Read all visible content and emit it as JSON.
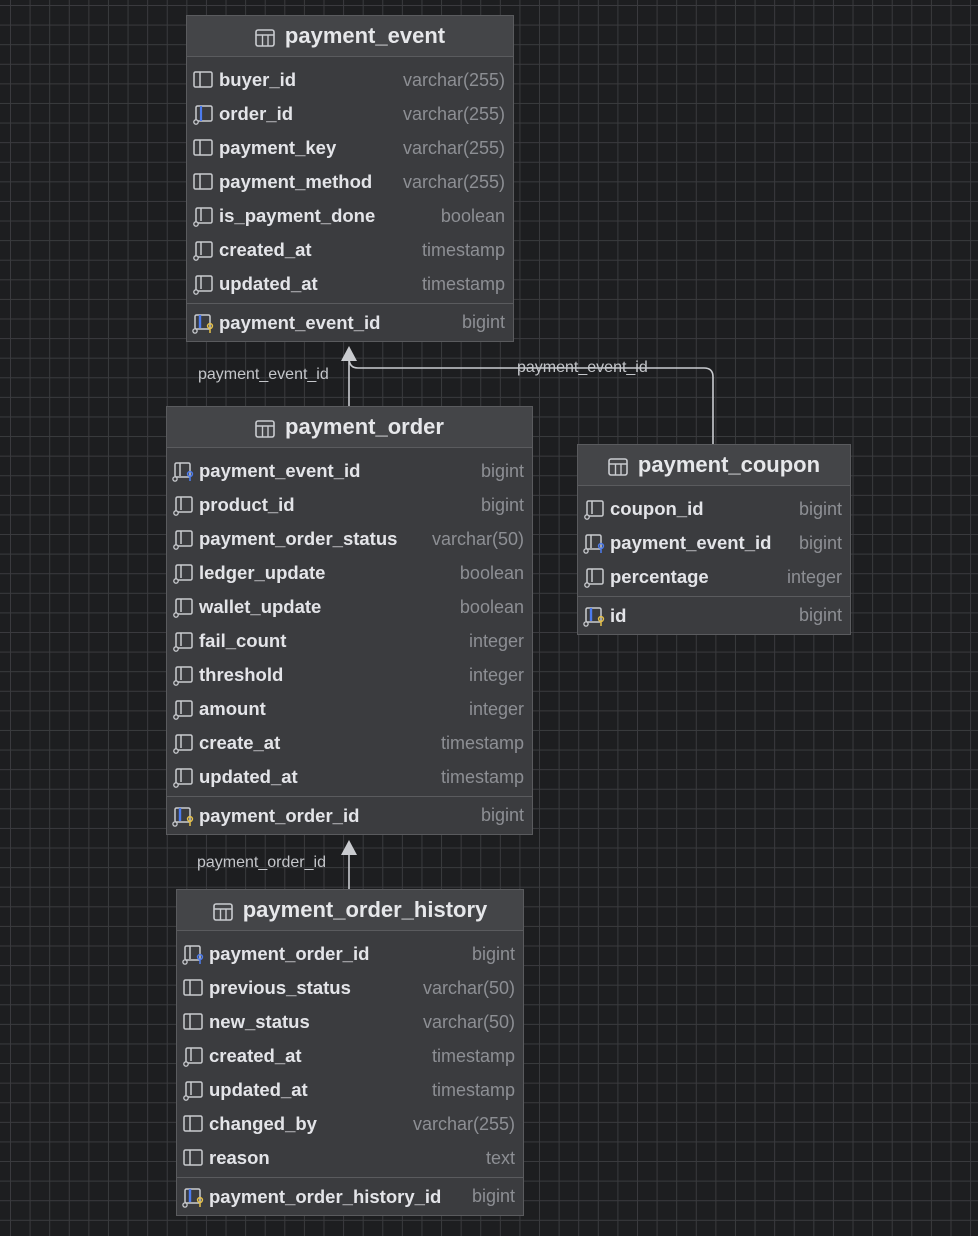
{
  "tables": {
    "payment_event": {
      "title": "payment_event",
      "columns": [
        {
          "name": "buyer_id",
          "type": "varchar(255)",
          "icon": "column-icon"
        },
        {
          "name": "order_id",
          "type": "varchar(255)",
          "icon": "indexed-column-icon"
        },
        {
          "name": "payment_key",
          "type": "varchar(255)",
          "icon": "column-icon"
        },
        {
          "name": "payment_method",
          "type": "varchar(255)",
          "icon": "column-icon"
        },
        {
          "name": "is_payment_done",
          "type": "boolean",
          "icon": "not-null-column-icon"
        },
        {
          "name": "created_at",
          "type": "timestamp",
          "icon": "not-null-column-icon"
        },
        {
          "name": "updated_at",
          "type": "timestamp",
          "icon": "not-null-column-icon"
        }
      ],
      "pk": {
        "name": "payment_event_id",
        "type": "bigint",
        "icon": "primary-key-icon"
      }
    },
    "payment_order": {
      "title": "payment_order",
      "columns": [
        {
          "name": "payment_event_id",
          "type": "bigint",
          "icon": "foreign-key-icon"
        },
        {
          "name": "product_id",
          "type": "bigint",
          "icon": "not-null-column-icon"
        },
        {
          "name": "payment_order_status",
          "type": "varchar(50)",
          "icon": "not-null-column-icon"
        },
        {
          "name": "ledger_update",
          "type": "boolean",
          "icon": "not-null-column-icon"
        },
        {
          "name": "wallet_update",
          "type": "boolean",
          "icon": "not-null-column-icon"
        },
        {
          "name": "fail_count",
          "type": "integer",
          "icon": "not-null-column-icon"
        },
        {
          "name": "threshold",
          "type": "integer",
          "icon": "not-null-column-icon"
        },
        {
          "name": "amount",
          "type": "integer",
          "icon": "not-null-column-icon"
        },
        {
          "name": "create_at",
          "type": "timestamp",
          "icon": "not-null-column-icon"
        },
        {
          "name": "updated_at",
          "type": "timestamp",
          "icon": "not-null-column-icon"
        }
      ],
      "pk": {
        "name": "payment_order_id",
        "type": "bigint",
        "icon": "primary-key-icon"
      }
    },
    "payment_coupon": {
      "title": "payment_coupon",
      "columns": [
        {
          "name": "coupon_id",
          "type": "bigint",
          "icon": "not-null-column-icon"
        },
        {
          "name": "payment_event_id",
          "type": "bigint",
          "icon": "foreign-key-icon"
        },
        {
          "name": "percentage",
          "type": "integer",
          "icon": "not-null-column-icon"
        }
      ],
      "pk": {
        "name": "id",
        "type": "bigint",
        "icon": "primary-key-icon"
      }
    },
    "payment_order_history": {
      "title": "payment_order_history",
      "columns": [
        {
          "name": "payment_order_id",
          "type": "bigint",
          "icon": "foreign-key-icon"
        },
        {
          "name": "previous_status",
          "type": "varchar(50)",
          "icon": "column-icon"
        },
        {
          "name": "new_status",
          "type": "varchar(50)",
          "icon": "column-icon"
        },
        {
          "name": "created_at",
          "type": "timestamp",
          "icon": "not-null-column-icon"
        },
        {
          "name": "updated_at",
          "type": "timestamp",
          "icon": "not-null-column-icon"
        },
        {
          "name": "changed_by",
          "type": "varchar(255)",
          "icon": "column-icon"
        },
        {
          "name": "reason",
          "type": "text",
          "icon": "column-icon"
        }
      ],
      "pk": {
        "name": "payment_order_history_id",
        "type": "bigint",
        "icon": "primary-key-icon"
      }
    }
  },
  "relations": {
    "order_to_event": "payment_event_id",
    "coupon_to_event": "payment_event_id",
    "history_to_order": "payment_order_id"
  },
  "colors": {
    "background": "#1d1e20",
    "table_fill": "#3b3c3f",
    "header_fill": "#444548",
    "fk_accent": "#4d7cf0",
    "pk_accent": "#e6c14a"
  }
}
